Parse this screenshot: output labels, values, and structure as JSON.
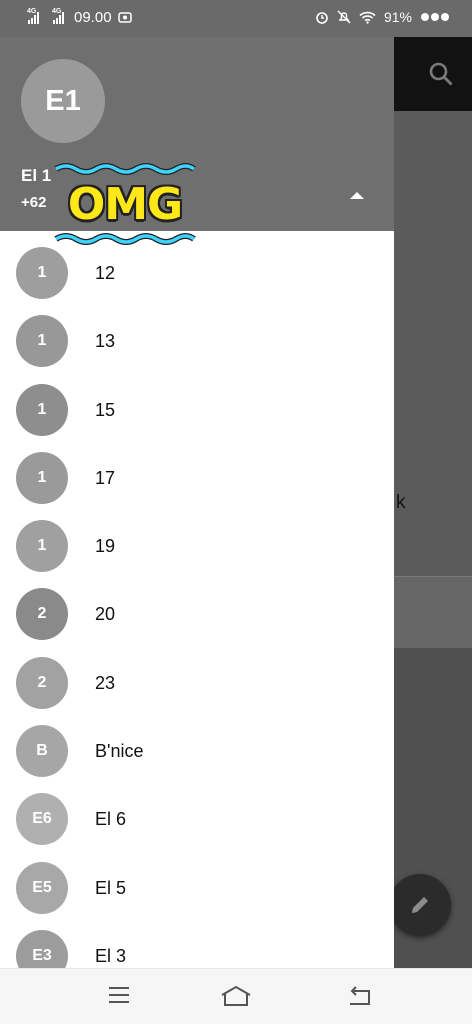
{
  "status_bar": {
    "network_1": "4G",
    "network_2": "4G",
    "time": "09.00",
    "battery": "91%"
  },
  "drawer": {
    "header": {
      "avatar_initials": "E1",
      "account_name": "El 1",
      "phone": "+62",
      "sticker_text": "OMG"
    },
    "contacts": [
      {
        "initial": "1",
        "name": "12",
        "color": "#9e9e9e"
      },
      {
        "initial": "1",
        "name": "13",
        "color": "#989898"
      },
      {
        "initial": "1",
        "name": "15",
        "color": "#8e8e8e"
      },
      {
        "initial": "1",
        "name": "17",
        "color": "#9a9a9a"
      },
      {
        "initial": "1",
        "name": "19",
        "color": "#a0a0a0"
      },
      {
        "initial": "2",
        "name": "20",
        "color": "#8a8a8a"
      },
      {
        "initial": "2",
        "name": "23",
        "color": "#a2a2a2"
      },
      {
        "initial": "B",
        "name": "B'nice",
        "color": "#a6a6a6"
      },
      {
        "initial": "E6",
        "name": "El 6",
        "color": "#b0b0b0"
      },
      {
        "initial": "E5",
        "name": "El 5",
        "color": "#a8a8a8"
      },
      {
        "initial": "E3",
        "name": "El 3",
        "color": "#9c9c9c"
      }
    ]
  },
  "background_app": {
    "partial_text": "k"
  },
  "icons": {
    "search": "search-icon",
    "edit": "pencil-icon",
    "menu": "menu-icon",
    "home": "home-icon",
    "back": "back-icon"
  }
}
